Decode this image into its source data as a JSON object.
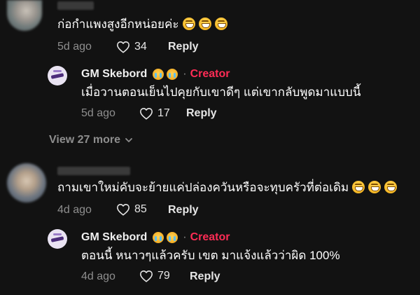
{
  "comments": [
    {
      "text": "ก่อกำแพงสูงอีกหน่อยค่ะ",
      "emoji_count": 3,
      "age": "5d ago",
      "likes": "34",
      "reply_label": "Reply",
      "replies": [
        {
          "author": "GM Skebord",
          "role": "Creator",
          "separator": "·",
          "text": "เมื่อวานตอนเย็นไปคุยกับเขาดีๆ แต่เขากลับพูดมาแบบนี้",
          "age": "5d ago",
          "likes": "17",
          "reply_label": "Reply"
        }
      ],
      "view_more": "View 27 more"
    },
    {
      "text": "ถามเขาใหม่คับจะย้ายแค่ปล่องควันหรือจะทุบครัวที่ต่อเดิม",
      "emoji_count": 3,
      "age": "4d ago",
      "likes": "85",
      "reply_label": "Reply",
      "replies": [
        {
          "author": "GM Skebord",
          "role": "Creator",
          "separator": "·",
          "text": "ตอนนี้ หนาวๆแล้วครับ เขต มาแจ้งแล้วว่าผิด 100%",
          "age": "4d ago",
          "likes": "79",
          "reply_label": "Reply"
        }
      ]
    }
  ],
  "colors": {
    "background": "#121212",
    "creator_accent": "#fe2c55",
    "muted_text": "#8e8e8e"
  },
  "icons": {
    "like": "heart-outline-icon",
    "expand": "chevron-down-icon",
    "emoji": "grinning-face-icon",
    "badge": "crying-face-icon"
  }
}
